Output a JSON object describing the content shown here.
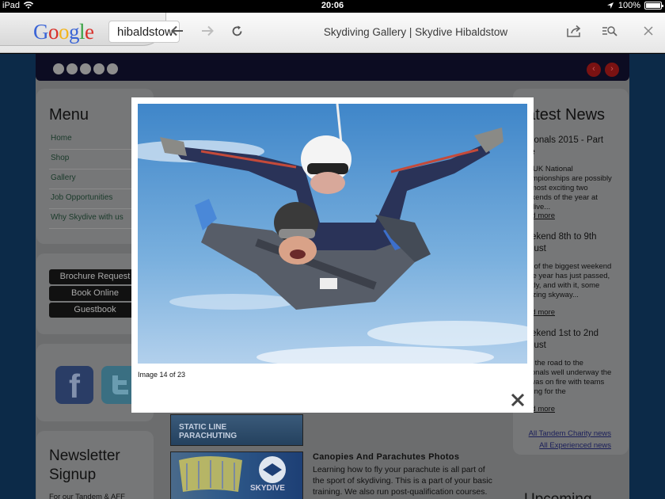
{
  "status_bar": {
    "carrier": "iPad",
    "time": "20:06",
    "battery": "100%"
  },
  "browser": {
    "search_logo": "Google",
    "search_value": "hibaldstow",
    "page_title": "Skydiving Gallery | Skydive Hibaldstow"
  },
  "sidebar": {
    "menu_title": "Menu",
    "menu_items": [
      {
        "label": "Home"
      },
      {
        "label": "Shop"
      },
      {
        "label": "Gallery"
      },
      {
        "label": "Job Opportunities"
      },
      {
        "label": "Why Skydive with us"
      }
    ],
    "buttons": {
      "brochure": "Brochure Request",
      "book": "Book Online",
      "guestbook": "Guestbook"
    },
    "newsletter_title": "Newsletter Signup",
    "newsletter_text": "For our Tandem & AFF"
  },
  "news": {
    "title": "Latest News",
    "items": [
      {
        "title": "Nationals 2015 - Part One",
        "body": "The UK National Championships are possibly the most exciting two weekends of the year at Skydive...",
        "more": "Read more"
      },
      {
        "title": "Weekend 8th to 9th August",
        "body": "One of the biggest weekend of the year has just passed, quietly, and with it, some amazing skyway...",
        "more": "Read more"
      },
      {
        "title": "Weekend 1st to 2nd August",
        "body": "With the road to the Nationals well underway the DZ was on fire with teams training for the",
        "more": "Read more"
      }
    ],
    "links": {
      "tandem_charity": "All Tandem Charity news",
      "experienced": "All Experienced news"
    },
    "upcoming_title": "Upcoming"
  },
  "gallery": {
    "static_line_thumb": "STATIC LINE PARACHUTING",
    "canopies_thumb": "SKYDIVE",
    "canopies_title": "Canopies And Parachutes Photos",
    "canopies_text": "Learning how to fly your parachute is all part of the sport of skydiving. This is a part of your basic training. We also run post-qualification courses. See"
  },
  "lightbox": {
    "caption": "Image 14 of 23"
  }
}
